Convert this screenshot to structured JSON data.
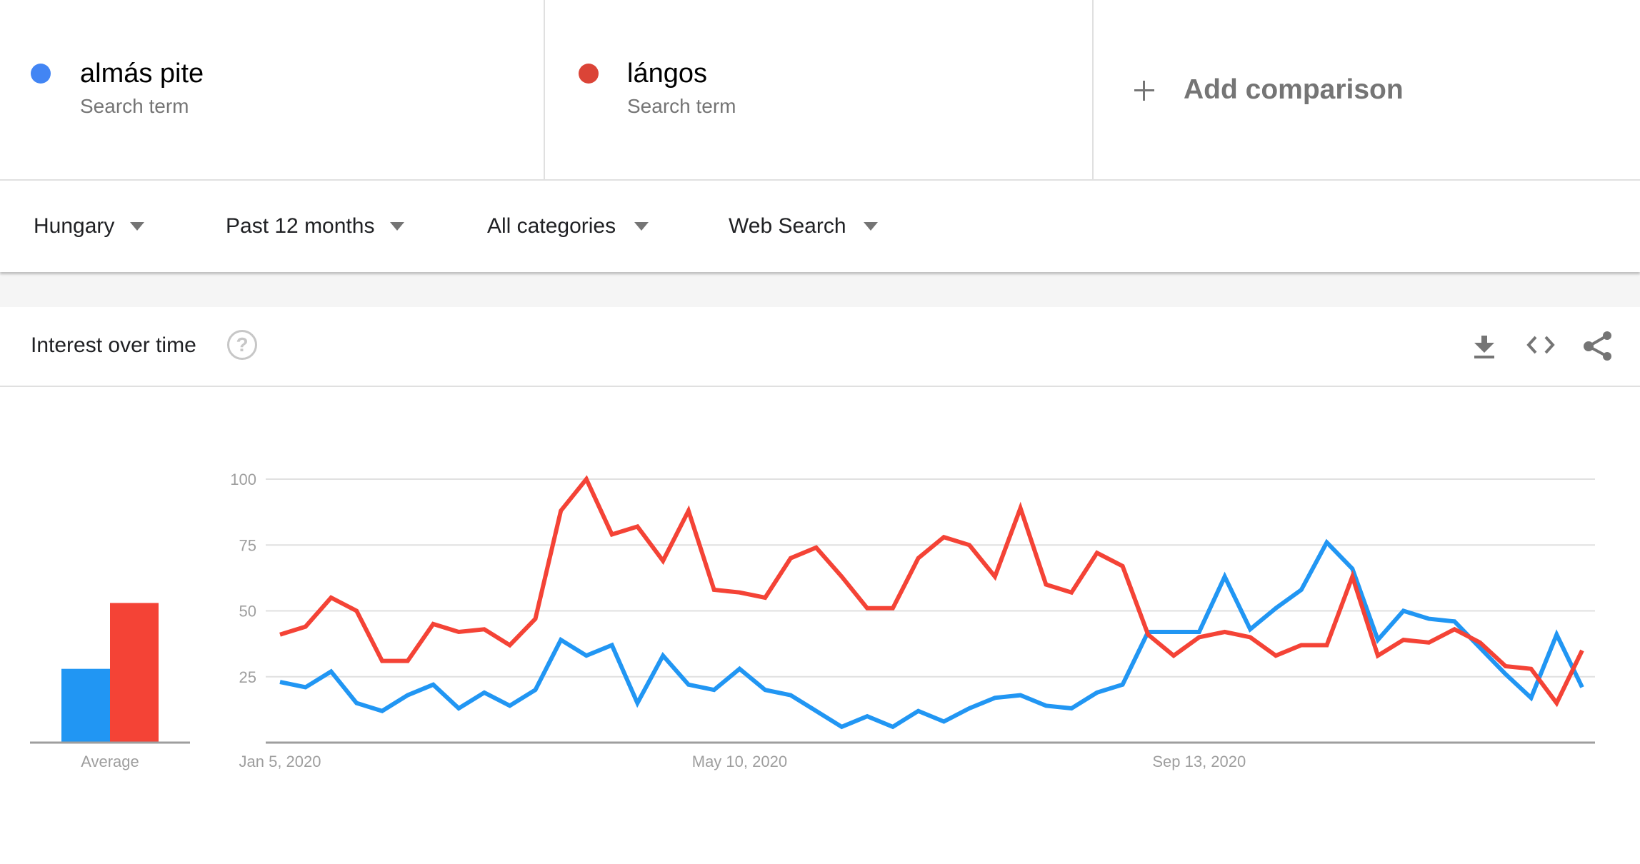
{
  "terms": [
    {
      "name": "almás pite",
      "subtitle": "Search term",
      "color": "#4285f4"
    },
    {
      "name": "lángos",
      "subtitle": "Search term",
      "color": "#db4437"
    }
  ],
  "add_comparison": {
    "label": "Add comparison",
    "icon": "plus-icon"
  },
  "filters": [
    {
      "label": "Hungary",
      "icon": "caret-down-icon"
    },
    {
      "label": "Past 12 months",
      "icon": "caret-down-icon"
    },
    {
      "label": "All categories",
      "icon": "caret-down-icon"
    },
    {
      "label": "Web Search",
      "icon": "caret-down-icon"
    }
  ],
  "card": {
    "title": "Interest over time",
    "help_icon": "?",
    "actions": [
      "download-icon",
      "embed-code-icon",
      "share-icon"
    ]
  },
  "chart_data": {
    "type": "line",
    "title": "Interest over time",
    "xlabel": "",
    "ylabel": "",
    "ylim": [
      0,
      100
    ],
    "yticks": [
      25,
      50,
      75,
      100
    ],
    "grid": true,
    "x_tick_labels": [
      {
        "index": 0,
        "label": "Jan 5, 2020"
      },
      {
        "index": 18,
        "label": "May 10, 2020"
      },
      {
        "index": 36,
        "label": "Sep 13, 2020"
      }
    ],
    "n_points": 52,
    "series": [
      {
        "name": "almás pite",
        "color": "#2196f3",
        "values": [
          23,
          21,
          27,
          15,
          12,
          18,
          22,
          13,
          19,
          14,
          20,
          39,
          33,
          37,
          15,
          33,
          22,
          20,
          28,
          20,
          18,
          12,
          6,
          10,
          6,
          12,
          8,
          13,
          17,
          18,
          14,
          13,
          19,
          22,
          42,
          42,
          42,
          63,
          43,
          51,
          58,
          76,
          66,
          39,
          50,
          47,
          46,
          36,
          26,
          17,
          41,
          21
        ]
      },
      {
        "name": "lángos",
        "color": "#f44336",
        "values": [
          41,
          44,
          55,
          50,
          31,
          31,
          45,
          42,
          43,
          37,
          47,
          88,
          100,
          79,
          82,
          69,
          88,
          58,
          57,
          55,
          70,
          74,
          63,
          51,
          51,
          70,
          78,
          75,
          63,
          89,
          60,
          57,
          72,
          67,
          41,
          33,
          40,
          42,
          40,
          33,
          37,
          37,
          63,
          33,
          39,
          38,
          43,
          38,
          29,
          28,
          15,
          35
        ]
      }
    ],
    "average": {
      "label": "Average",
      "values": [
        {
          "name": "almás pite",
          "value": 28,
          "color": "#2196f3"
        },
        {
          "name": "lángos",
          "value": 53,
          "color": "#f44336"
        }
      ]
    }
  }
}
